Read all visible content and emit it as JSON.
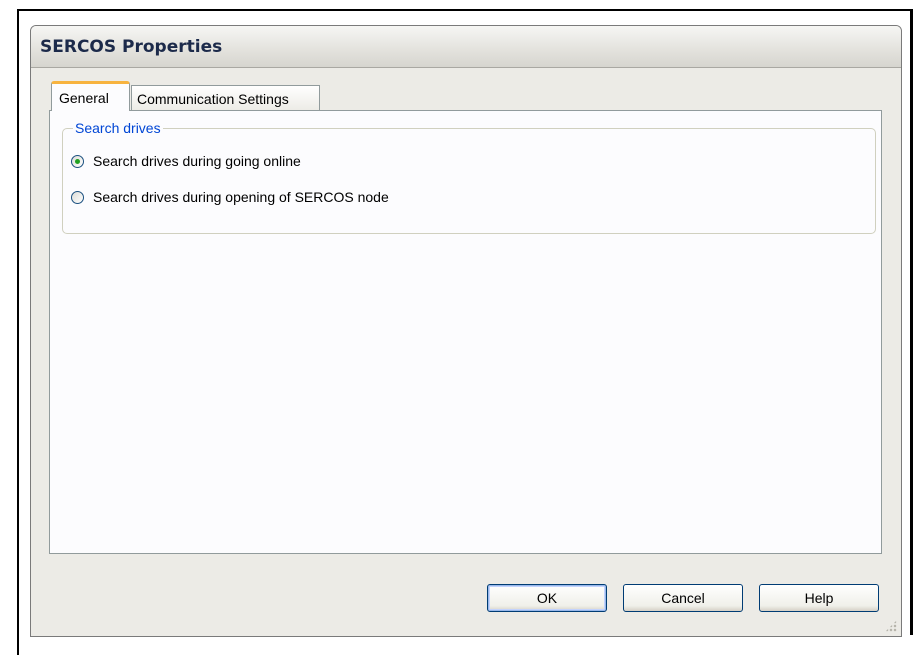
{
  "dialog": {
    "title": "SERCOS Properties",
    "tabs": [
      {
        "label": "General",
        "active": true
      },
      {
        "label": "Communication Settings",
        "active": false
      }
    ],
    "group": {
      "legend": "Search drives",
      "options": [
        {
          "label": "Search drives during going online",
          "checked": true
        },
        {
          "label": "Search drives during opening of SERCOS node",
          "checked": false
        }
      ]
    },
    "buttons": {
      "ok": "OK",
      "cancel": "Cancel",
      "help": "Help"
    }
  }
}
